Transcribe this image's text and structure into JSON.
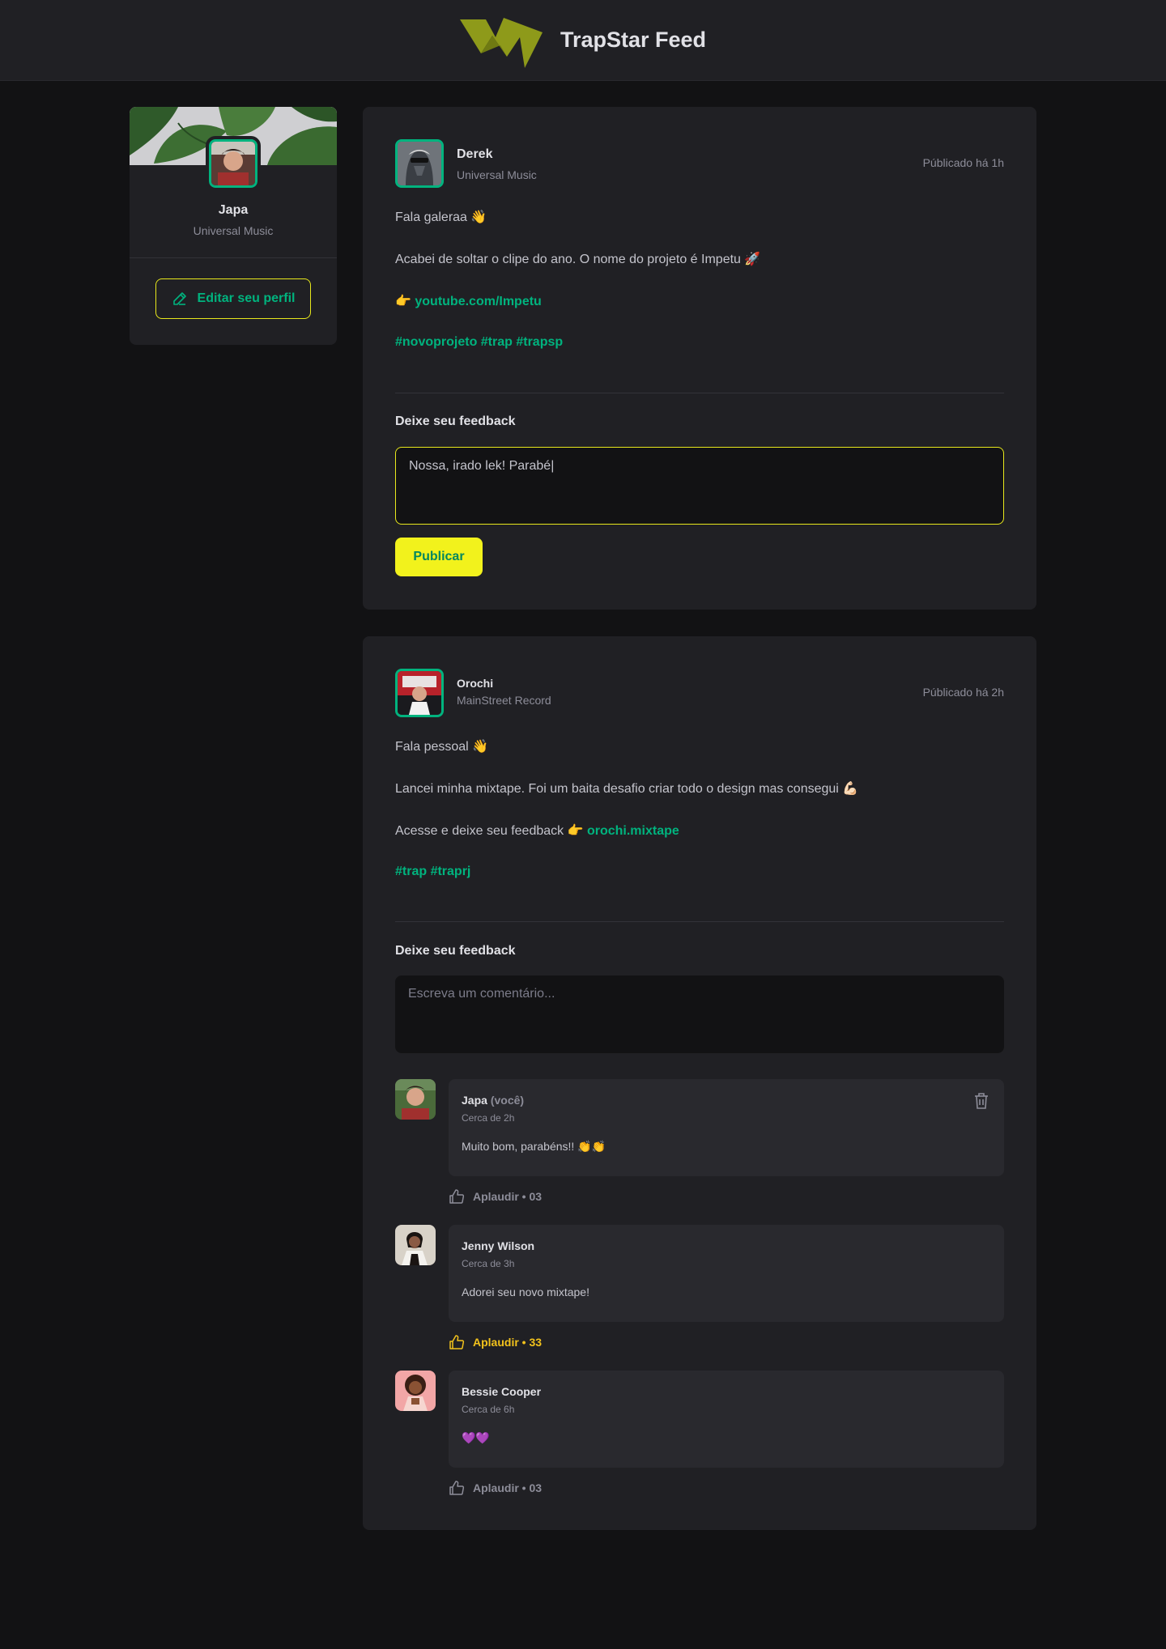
{
  "header": {
    "title": "TrapStar Feed"
  },
  "colors": {
    "accent_green": "#00b37e",
    "accent_yellow": "#e8e81c",
    "applaud_active": "#f2c21c"
  },
  "sidebar": {
    "name": "Japa",
    "company": "Universal Music",
    "edit_label": "Editar seu perfil"
  },
  "posts": [
    {
      "author": "Derek",
      "role": "Universal Music",
      "time": "Públicado há 1h",
      "lines": [
        "Fala galeraa 👋",
        "Acabei de soltar o clipe do ano. O nome do projeto é Impetu 🚀"
      ],
      "link_prefix": "👉 ",
      "link": "youtube.com/Impetu",
      "hashtags": "#novoprojeto #trap #trapsp",
      "feedback_title": "Deixe seu feedback",
      "comment_value": "Nossa, irado lek! Parabé|",
      "publish_label": "Publicar"
    },
    {
      "author": "Orochi",
      "role": "MainStreet Record",
      "time": "Públicado há 2h",
      "lines": [
        "Fala pessoal 👋",
        "Lancei minha mixtape. Foi um baita desafio criar todo o design mas consegui 💪🏻"
      ],
      "link_prefix": "Acesse e deixe seu feedback 👉 ",
      "link": "orochi.mixtape",
      "hashtags": "#trap #traprj",
      "feedback_title": "Deixe seu feedback",
      "comment_placeholder": "Escreva um comentário...",
      "comments": [
        {
          "name": "Japa",
          "you": "(você)",
          "time": "Cerca de 2h",
          "text": "Muito bom, parabéns!! 👏👏",
          "applaud": "Aplaudir • 03",
          "active": false
        },
        {
          "name": "Jenny Wilson",
          "time": "Cerca de 3h",
          "text": "Adorei seu novo mixtape!",
          "applaud": "Aplaudir • 33",
          "active": true
        },
        {
          "name": "Bessie Cooper",
          "time": "Cerca de 6h",
          "text": "💜💜",
          "applaud": "Aplaudir • 03",
          "active": false
        }
      ]
    }
  ]
}
